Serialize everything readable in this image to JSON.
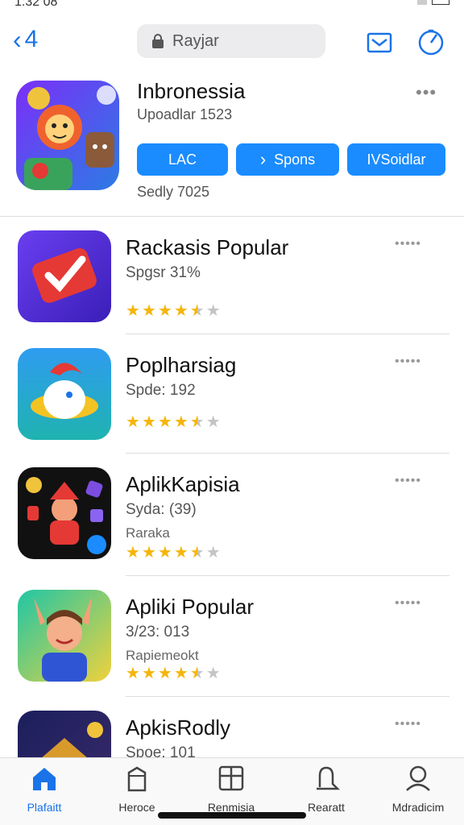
{
  "status": {
    "time": "1:32 08"
  },
  "nav": {
    "back_label": "4",
    "back_icon": "chevron-left-icon",
    "search_label": "Rayjar",
    "search_icon": "lock-icon",
    "right_icons": [
      "mail-icon",
      "compass-icon"
    ],
    "accent": "#1a73e8"
  },
  "featured": {
    "title": "Inbronessia",
    "subtitle": "Upoadlar 1523",
    "more": "•••",
    "buttons": [
      {
        "label": "LAC",
        "icon": ""
      },
      {
        "label": "Spons",
        "icon": "chevron-right-icon"
      },
      {
        "label": "IVSoidlar",
        "icon": ""
      }
    ],
    "footer": "Sedly 7025",
    "button_color": "#1a8cff"
  },
  "apps": [
    {
      "title": "Rackasis Popular",
      "line1": "Spgsr 31%",
      "line2": "",
      "rating": 4.5,
      "more": "•••••",
      "icon": "checkmark-app-icon"
    },
    {
      "title": "Poplharsiag",
      "line1": "Spde: 192",
      "line2": "",
      "rating": 4.5,
      "more": "•••••",
      "icon": "bird-app-icon"
    },
    {
      "title": "AplikKapisia",
      "line1": "Syda: (39)",
      "line2": "Raraka",
      "rating": 4.5,
      "more": "•••••",
      "icon": "character-app-icon"
    },
    {
      "title": "Apliki Popular",
      "line1": "3/23: 013",
      "line2": "Rapiemeokt",
      "rating": 4.5,
      "more": "•••••",
      "icon": "avatar-app-icon"
    },
    {
      "title": "ApkisRodly",
      "line1": "Spoe: 101",
      "line2": "",
      "rating": 0,
      "more": "•••••",
      "icon": "castle-app-icon"
    }
  ],
  "tabs": [
    {
      "label": "Plafaitt",
      "icon": "home-icon",
      "active": true
    },
    {
      "label": "Heroce",
      "icon": "building-icon",
      "active": false
    },
    {
      "label": "Renmisia",
      "icon": "grid-icon",
      "active": false
    },
    {
      "label": "Rearatt",
      "icon": "bell-icon",
      "active": false
    },
    {
      "label": "Mdradicim",
      "icon": "person-icon",
      "active": false
    }
  ]
}
